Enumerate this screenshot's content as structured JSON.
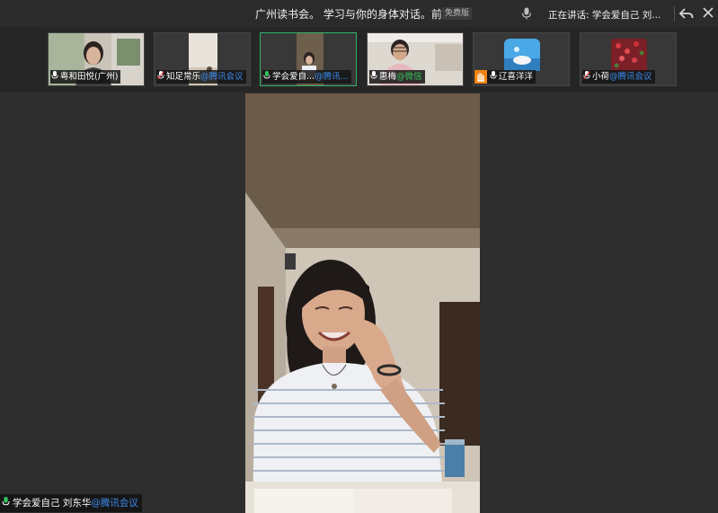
{
  "titlebar": {
    "meeting_title": "广州读书会。 学习与你的身体对话。前言",
    "free_badge": "免费版",
    "speaking_prefix": "正在讲话: ",
    "speaking_name": "学会爱自己 刘..."
  },
  "thumbnails": [
    {
      "name": "粤和田悦(广州)",
      "source": ""
    },
    {
      "name": "知足常乐",
      "source": "@腾讯会议"
    },
    {
      "name": "学会爱自...",
      "source": "@腾讯..."
    },
    {
      "name": "惠梅",
      "source": "@微信"
    },
    {
      "name": "辽喜洋洋",
      "source": ""
    },
    {
      "name": "小荷",
      "source": "@腾讯会议"
    }
  ],
  "main_speaker": {
    "name": "学会爱自己 刘东华",
    "source": "@腾讯会议"
  },
  "colors": {
    "active_border": "#2fb36a",
    "source_blue": "#3d8cf0",
    "source_green": "#32c25a"
  }
}
